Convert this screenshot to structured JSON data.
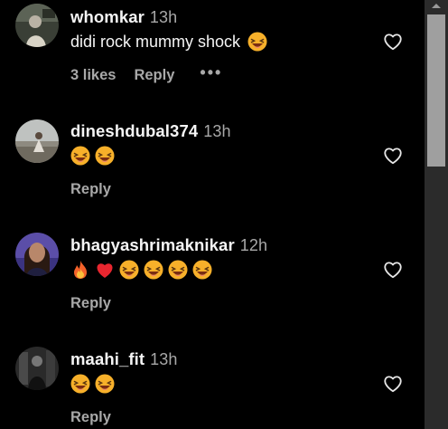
{
  "comments": [
    {
      "username": "whomkar",
      "time": "13h",
      "text": "didi rock mummy shock",
      "emojis": [
        "grinning-squinting-face"
      ],
      "likes": "3 likes",
      "reply": "Reply",
      "more": "•••",
      "avatar": "avatar-person-outdoors"
    },
    {
      "username": "dineshdubal374",
      "time": "13h",
      "text": "",
      "emojis": [
        "grinning-squinting-face",
        "grinning-squinting-face"
      ],
      "reply": "Reply",
      "avatar": "avatar-person-sitting-rock"
    },
    {
      "username": "bhagyashrimaknikar",
      "time": "12h",
      "text": "",
      "emojis": [
        "fire",
        "red-heart",
        "grinning-squinting-face",
        "grinning-squinting-face",
        "grinning-squinting-face",
        "grinning-squinting-face"
      ],
      "reply": "Reply",
      "avatar": "avatar-girl-portrait"
    },
    {
      "username": "maahi_fit",
      "time": "13h",
      "text": "",
      "emojis": [
        "grinning-squinting-face",
        "grinning-squinting-face"
      ],
      "reply": "Reply",
      "avatar": "avatar-person-dark-photo"
    }
  ],
  "icons": {
    "like": "heart-outline-icon",
    "scroll_up": "scroll-up-arrow-icon"
  },
  "colors": {
    "background": "#000000",
    "primary_text": "#f5f5f5",
    "secondary_text": "#a8a8a8",
    "scrollbar_track": "#2b2b2b",
    "scrollbar_thumb": "#9f9f9f"
  }
}
